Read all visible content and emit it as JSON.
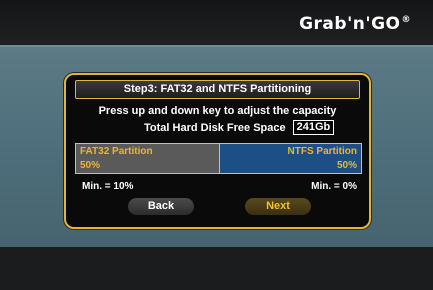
{
  "brand": {
    "logo_text": "Grab'n'GO",
    "registered_mark": "®"
  },
  "dialog": {
    "title": "Step3: FAT32 and NTFS Partitioning",
    "instruction": "Press up and down key to adjust the capacity",
    "free_space_label": "Total Hard Disk Free Space",
    "free_space_value": "241Gb",
    "fat32": {
      "label": "FAT32 Partition",
      "value": "50%",
      "min": "Min. = 10%"
    },
    "ntfs": {
      "label": "NTFS Partition",
      "value": "50%",
      "min": "Min. = 0%"
    },
    "buttons": {
      "back": "Back",
      "next": "Next"
    }
  },
  "colors": {
    "accent": "#e2b437",
    "fat32_cell": "#5a5a5a",
    "ntfs_cell": "#1c4f86",
    "background_band": "#4d6c79"
  }
}
